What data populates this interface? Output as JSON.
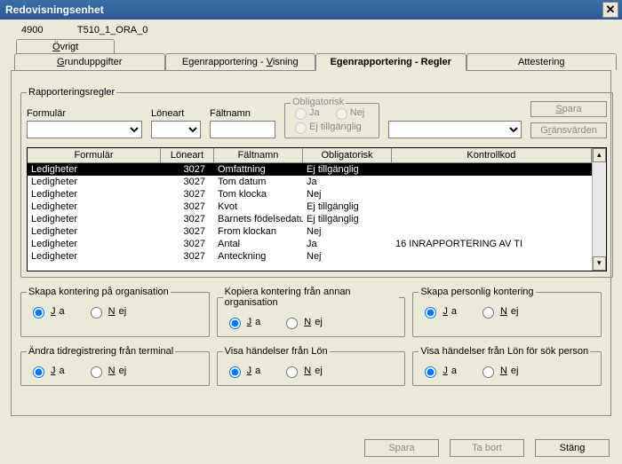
{
  "window": {
    "title": "Redovisningsenhet"
  },
  "header": {
    "org_id": "4900",
    "org_name": "T510_1_ORA_0",
    "top_tab": "Övrigt"
  },
  "tabs": {
    "t0": "Grunduppgifter",
    "t1": "Egenrapportering - Visning",
    "t2": "Egenrapportering - Regler",
    "t3": "Attestering"
  },
  "rules": {
    "legend": "Rapporteringsregler",
    "lbl_formular": "Formulär",
    "lbl_loneart": "Löneart",
    "lbl_faltnamn": "Fältnamn",
    "obl": {
      "legend": "Obligatorisk",
      "ja": "Ja",
      "nej": "Nej",
      "ej": "Ej tillgänglig"
    },
    "btn_spara": "Spara",
    "btn_grans": "Gränsvärden"
  },
  "grid": {
    "h_formular": "Formulär",
    "h_loneart": "Löneart",
    "h_faltnamn": "Fältnamn",
    "h_obl": "Obligatorisk",
    "h_kontroll": "Kontrollkod",
    "rows": [
      {
        "f": "Ledigheter",
        "l": "3027",
        "n": "Omfattning",
        "o": "Ej tillgänglig",
        "k": ""
      },
      {
        "f": "Ledigheter",
        "l": "3027",
        "n": "Tom datum",
        "o": "Ja",
        "k": ""
      },
      {
        "f": "Ledigheter",
        "l": "3027",
        "n": "Tom klocka",
        "o": "Nej",
        "k": ""
      },
      {
        "f": "Ledigheter",
        "l": "3027",
        "n": "Kvot",
        "o": "Ej tillgänglig",
        "k": ""
      },
      {
        "f": "Ledigheter",
        "l": "3027",
        "n": "Barnets födelsedatu",
        "o": "Ej tillgänglig",
        "k": ""
      },
      {
        "f": "Ledigheter",
        "l": "3027",
        "n": "From klockan",
        "o": "Nej",
        "k": ""
      },
      {
        "f": "Ledigheter",
        "l": "3027",
        "n": "Antal",
        "o": "Ja",
        "k": "16 INRAPPORTERING AV TI"
      },
      {
        "f": "Ledigheter",
        "l": "3027",
        "n": "Anteckning",
        "o": "Nej",
        "k": ""
      }
    ]
  },
  "opts": {
    "ja": "Ja",
    "nej": "Nej",
    "skapa_kont_org": "Skapa kontering på organisation",
    "kopiera_kont": "Kopiera kontering från annan organisation",
    "skapa_pers": "Skapa personlig kontering",
    "andra_tid": "Ändra tidregistrering från terminal",
    "visa_lon": "Visa händelser från Lön",
    "visa_lon_sok": "Visa händelser från Lön för sök person"
  },
  "footer": {
    "spara": "Spara",
    "tabort": "Ta bort",
    "stang": "Stäng"
  }
}
